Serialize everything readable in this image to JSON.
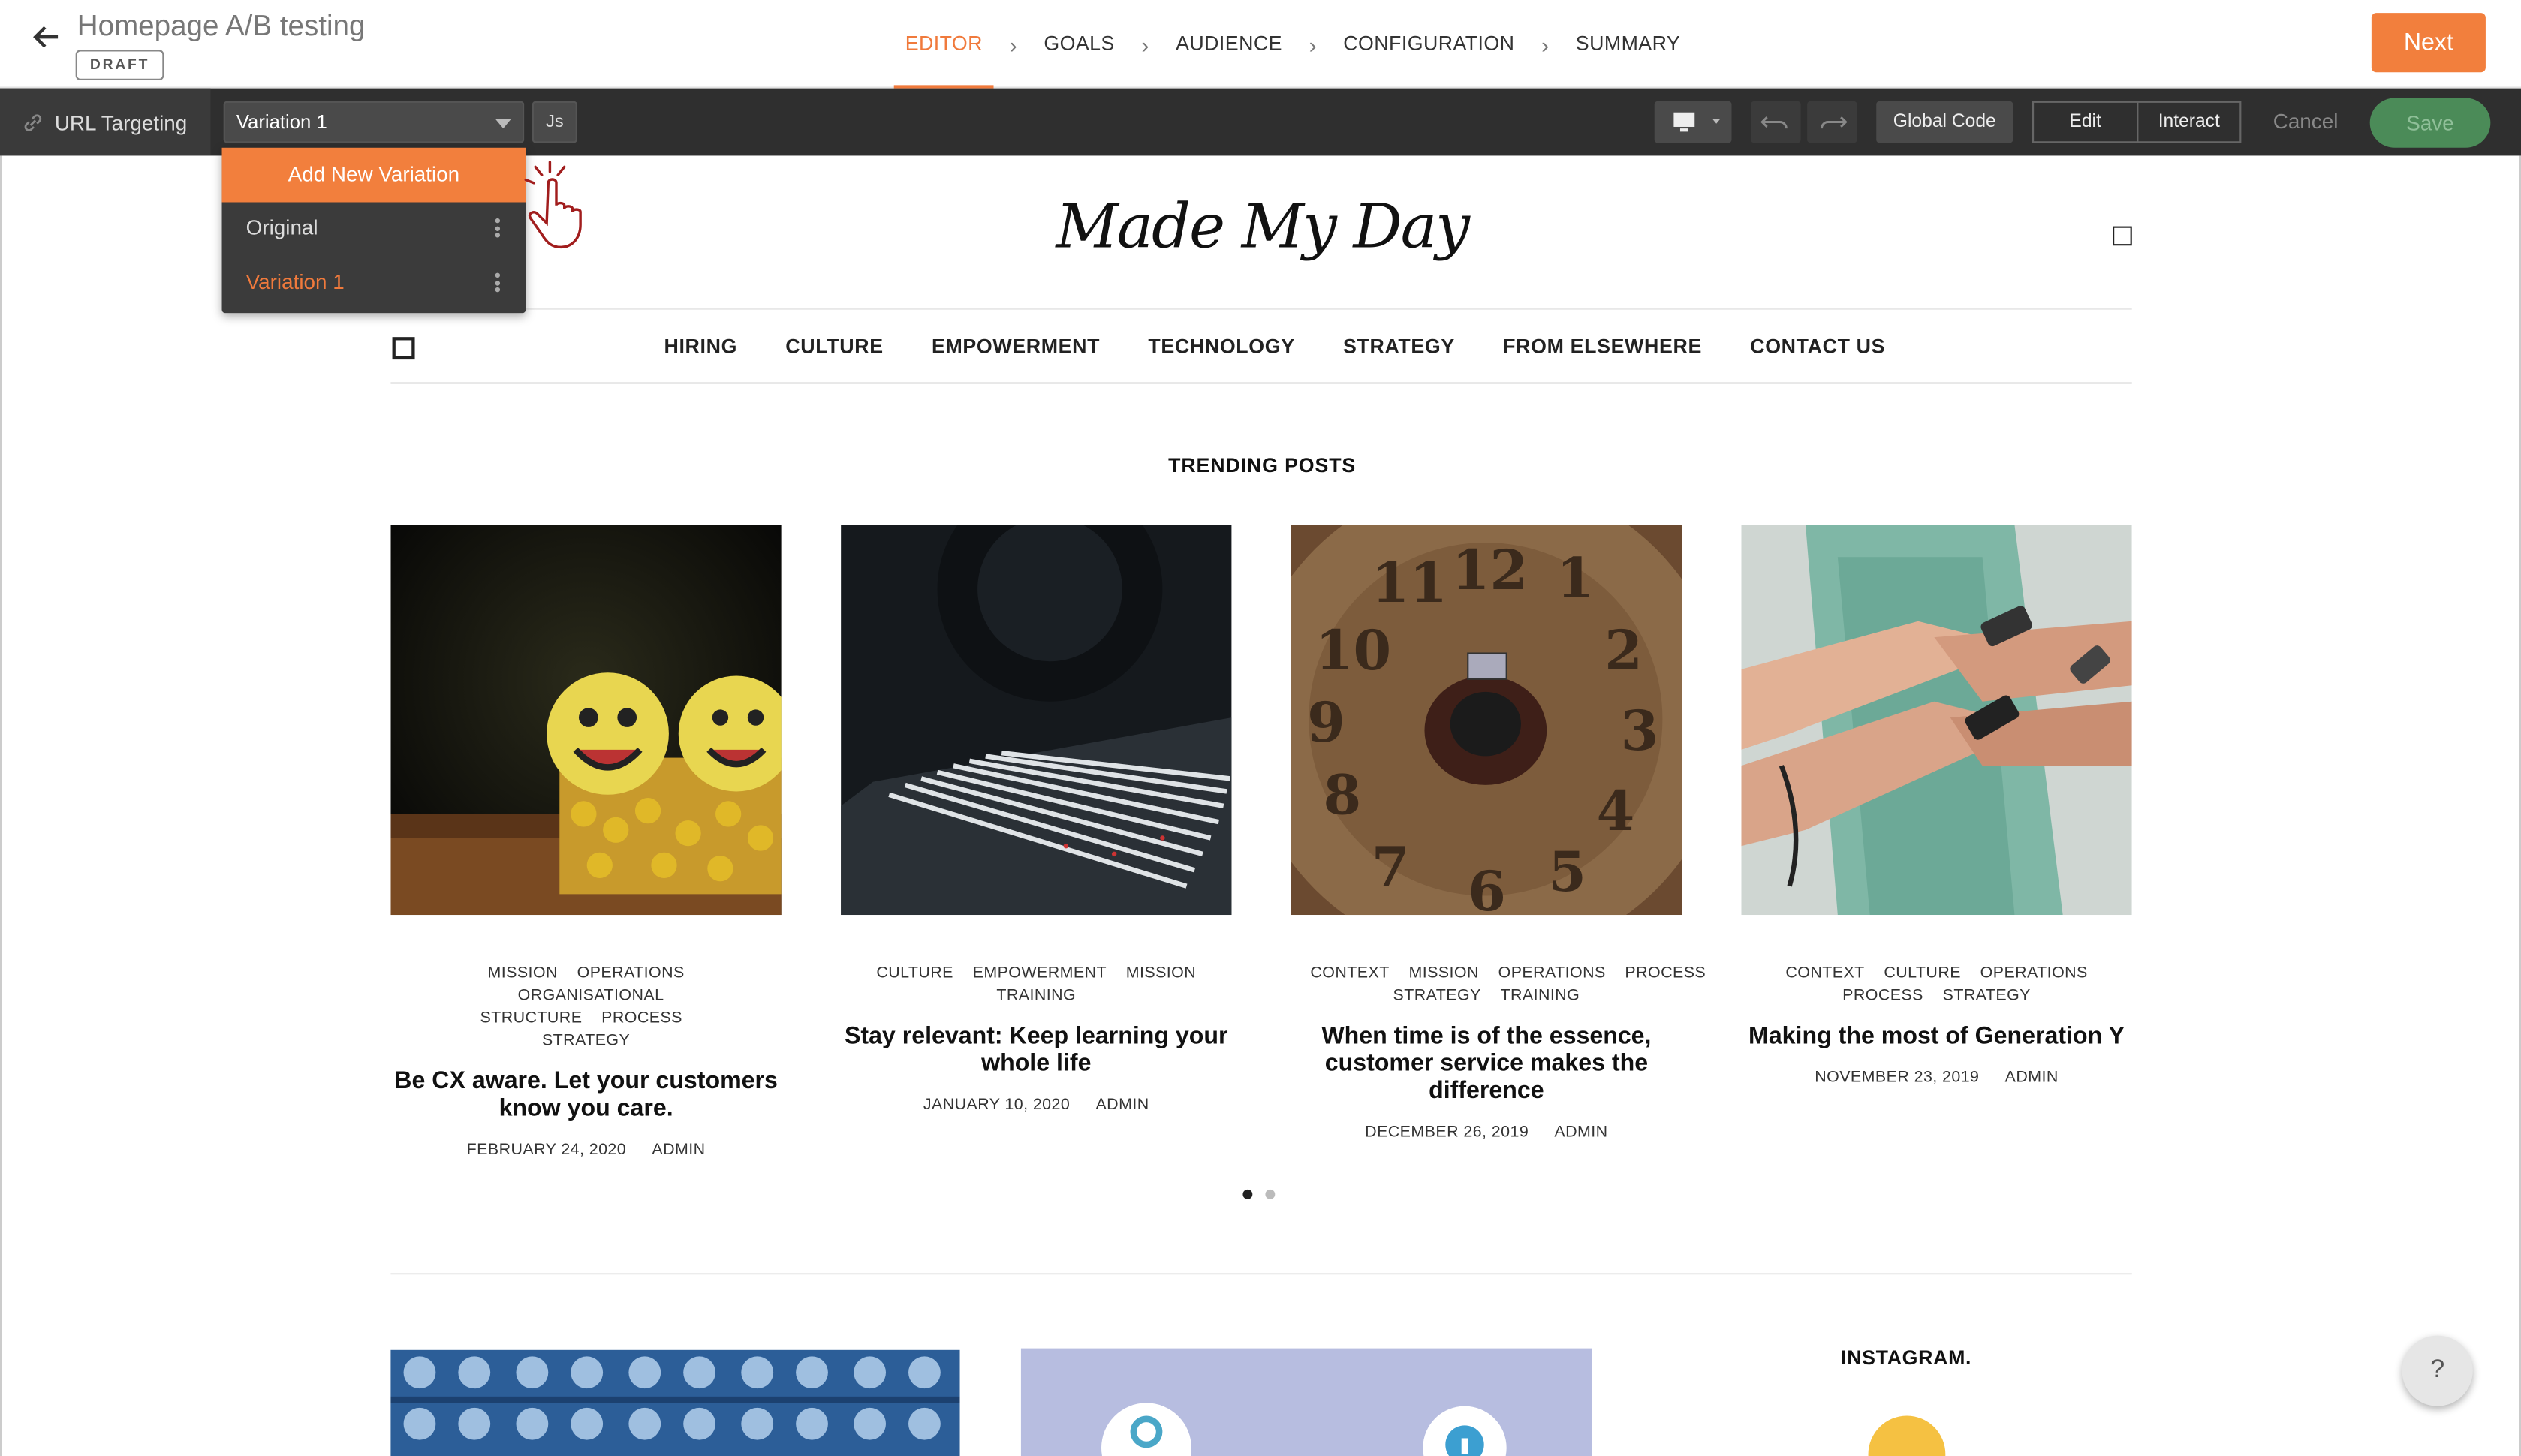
{
  "header": {
    "title": "Homepage A/B testing",
    "status_badge": "DRAFT",
    "steps": [
      "EDITOR",
      "GOALS",
      "AUDIENCE",
      "CONFIGURATION",
      "SUMMARY"
    ],
    "active_step": "EDITOR",
    "next_label": "Next",
    "accent_color": "#f27f3d"
  },
  "toolbar": {
    "url_targeting_label": "URL Targeting",
    "variation_selected": "Variation 1",
    "js_label": "Js",
    "global_code_label": "Global Code",
    "edit_label": "Edit",
    "interact_label": "Interact",
    "cancel_label": "Cancel",
    "save_label": "Save",
    "save_color": "#4b8b58"
  },
  "variation_menu": {
    "add_label": "Add New Variation",
    "items": [
      {
        "label": "Original",
        "active": false
      },
      {
        "label": "Variation 1",
        "active": true
      }
    ]
  },
  "site": {
    "logo": "Made My Day",
    "nav": [
      "HIRING",
      "CULTURE",
      "EMPOWERMENT",
      "TECHNOLOGY",
      "STRATEGY",
      "FROM ELSEWHERE",
      "CONTACT US"
    ],
    "section_title": "TRENDING POSTS",
    "posts": [
      {
        "cats_line1": [
          "MISSION",
          "OPERATIONS"
        ],
        "cats_line2": [
          "ORGANISATIONAL STRUCTURE",
          "PROCESS"
        ],
        "cats_line3": [
          "STRATEGY"
        ],
        "title": "Be CX aware. Let your customers know you care.",
        "date": "FEBRUARY 24, 2020",
        "author": "ADMIN"
      },
      {
        "cats_line1": [
          "CULTURE",
          "EMPOWERMENT",
          "MISSION"
        ],
        "cats_line2": [
          "TRAINING"
        ],
        "cats_line3": [],
        "title": "Stay relevant: Keep learning your whole life",
        "date": "JANUARY 10, 2020",
        "author": "ADMIN"
      },
      {
        "cats_line1": [
          "CONTEXT",
          "MISSION",
          "OPERATIONS",
          "PROCESS"
        ],
        "cats_line2": [
          "STRATEGY",
          "TRAINING"
        ],
        "cats_line3": [],
        "title": "When time is of the essence, customer service makes the difference",
        "date": "DECEMBER 26, 2019",
        "author": "ADMIN"
      },
      {
        "cats_line1": [
          "CONTEXT",
          "CULTURE",
          "OPERATIONS"
        ],
        "cats_line2": [
          "PROCESS",
          "STRATEGY"
        ],
        "cats_line3": [],
        "title": "Making the most of Generation Y",
        "date": "NOVEMBER 23, 2019",
        "author": "ADMIN"
      }
    ],
    "carousel": {
      "pages": 2,
      "current": 1
    },
    "instagram_title": "INSTAGRAM."
  },
  "help_label": "?"
}
